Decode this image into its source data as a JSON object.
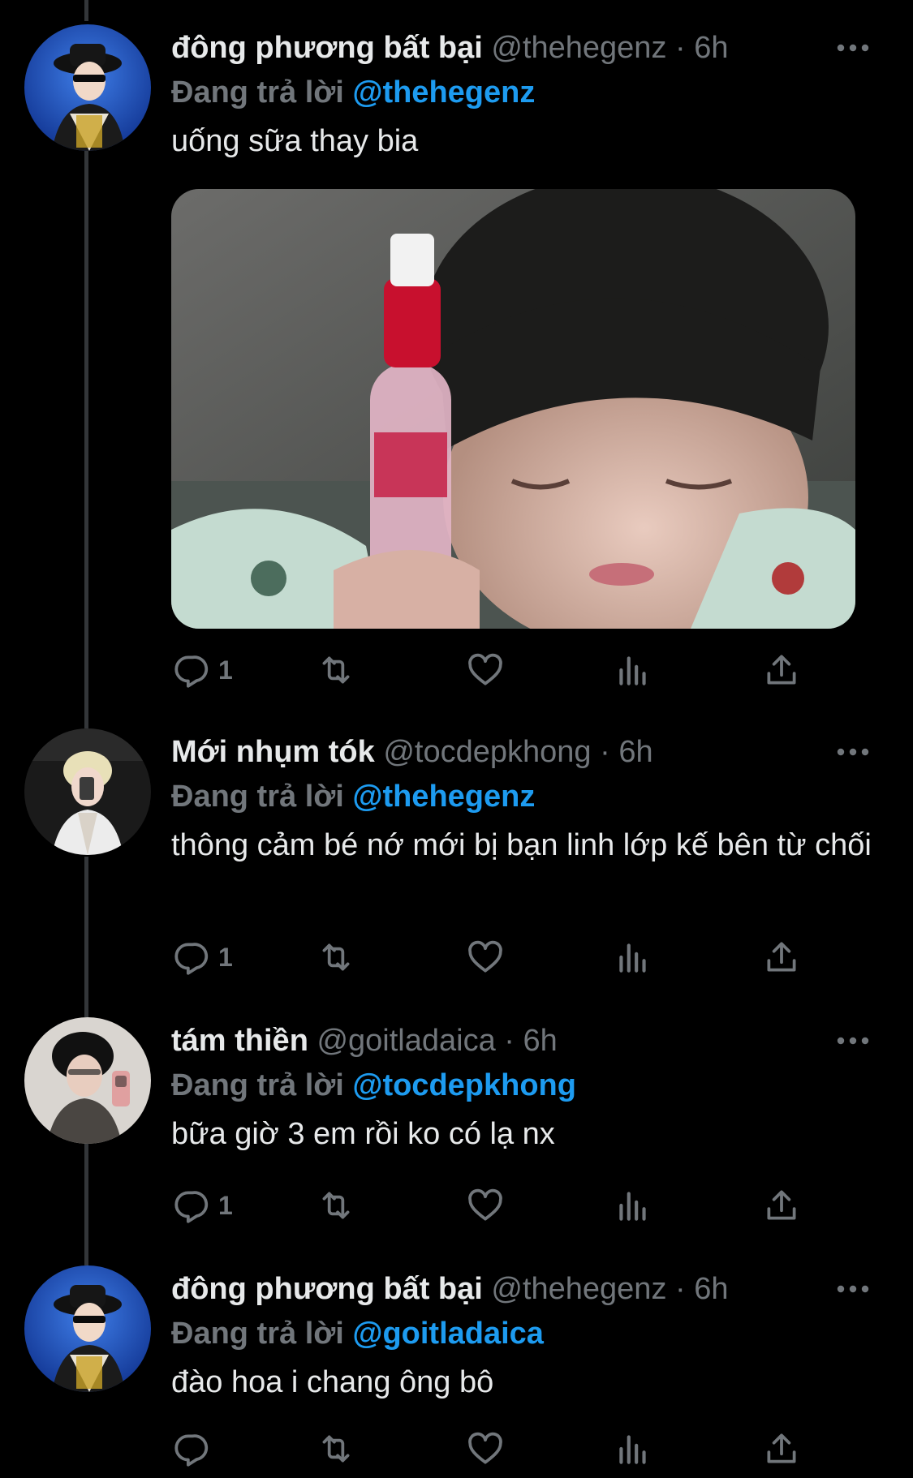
{
  "colors": {
    "background": "#000000",
    "text": "#e7e9ea",
    "muted": "#71767b",
    "accent": "#1d9bf0",
    "thread_line": "#333639"
  },
  "tweets": [
    {
      "name": "đông phương bất bại",
      "handle": "@thehegenz",
      "time": "6h",
      "replying_label": "Đang trả lời",
      "replying_to": "@thehegenz",
      "text": "uống sữa thay bia",
      "has_media": true,
      "reply_count": "1",
      "avatar_icon": "user-avatar"
    },
    {
      "name": "Mới nhụm tók",
      "handle": "@tocdepkhong",
      "time": "6h",
      "replying_label": "Đang trả lời",
      "replying_to": "@thehegenz",
      "text": "thông cảm bé nớ mới bị bạn linh lớp kế bên từ chối",
      "reply_count": "1",
      "avatar_icon": "user-avatar"
    },
    {
      "name": "tám thiền",
      "handle": "@goitladaica",
      "time": "6h",
      "replying_label": "Đang trả lời",
      "replying_to": "@tocdepkhong",
      "text": "bữa giờ 3 em rồi ko có lạ nx",
      "reply_count": "1",
      "avatar_icon": "user-avatar"
    },
    {
      "name": "đông phương bất bại",
      "handle": "@thehegenz",
      "time": "6h",
      "replying_label": "Đang trả lời",
      "replying_to": "@goitladaica",
      "text": "đào hoa i chang ông bô",
      "reply_count": "",
      "avatar_icon": "user-avatar"
    }
  ],
  "action_icons": [
    "reply-icon",
    "retweet-icon",
    "like-icon",
    "views-icon",
    "share-icon"
  ]
}
